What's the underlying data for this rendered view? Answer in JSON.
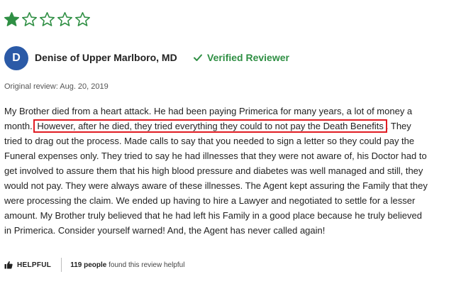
{
  "rating": {
    "value": 1,
    "max": 5,
    "filled_color": "#2f8f44",
    "empty_color": "#2f8f44"
  },
  "reviewer": {
    "avatar_initial": "D",
    "name": "Denise of Upper Marlboro, MD",
    "verified_label": "Verified Reviewer",
    "verified_icon": "checkmark-icon"
  },
  "original_review": "Original review: Aug. 20, 2019",
  "review": {
    "lines": [
      {
        "pre": "My Brother died from a heart attack. He had been paying Primerica for many years, a lot of money a",
        "highlight": "",
        "post": ""
      },
      {
        "pre": "month.",
        "highlight": "However, after he died, they tried everything they could to not pay the Death Benefits",
        "post": ". They"
      },
      {
        "pre": "tried to drag out the process. Made calls to say that you needed to sign a letter so they could pay the",
        "highlight": "",
        "post": ""
      },
      {
        "pre": "Funeral expenses only. They tried to say he had illnesses that they were not aware of, his Doctor had to",
        "highlight": "",
        "post": ""
      },
      {
        "pre": "get involved to assure them that his high blood pressure and diabetes was well managed and still, they",
        "highlight": "",
        "post": ""
      },
      {
        "pre": "would not pay. They were always aware of these illnesses. The Agent kept assuring the Family that they",
        "highlight": "",
        "post": ""
      },
      {
        "pre": "were processing the claim. We ended up having to hire a Lawyer and negotiated to settle for a lesser",
        "highlight": "",
        "post": ""
      },
      {
        "pre": "amount. My Brother truly believed that he had left his Family in a good place because he truly believed",
        "highlight": "",
        "post": ""
      },
      {
        "pre": "in Primerica. Consider yourself warned! And, the Agent has never called again!",
        "highlight": "",
        "post": ""
      }
    ],
    "highlight_color": "#e11d24"
  },
  "footer": {
    "helpful_label": "HELPFUL",
    "helpful_icon": "thumbs-up-icon",
    "count_people": "119 people",
    "count_rest": " found this review helpful"
  }
}
